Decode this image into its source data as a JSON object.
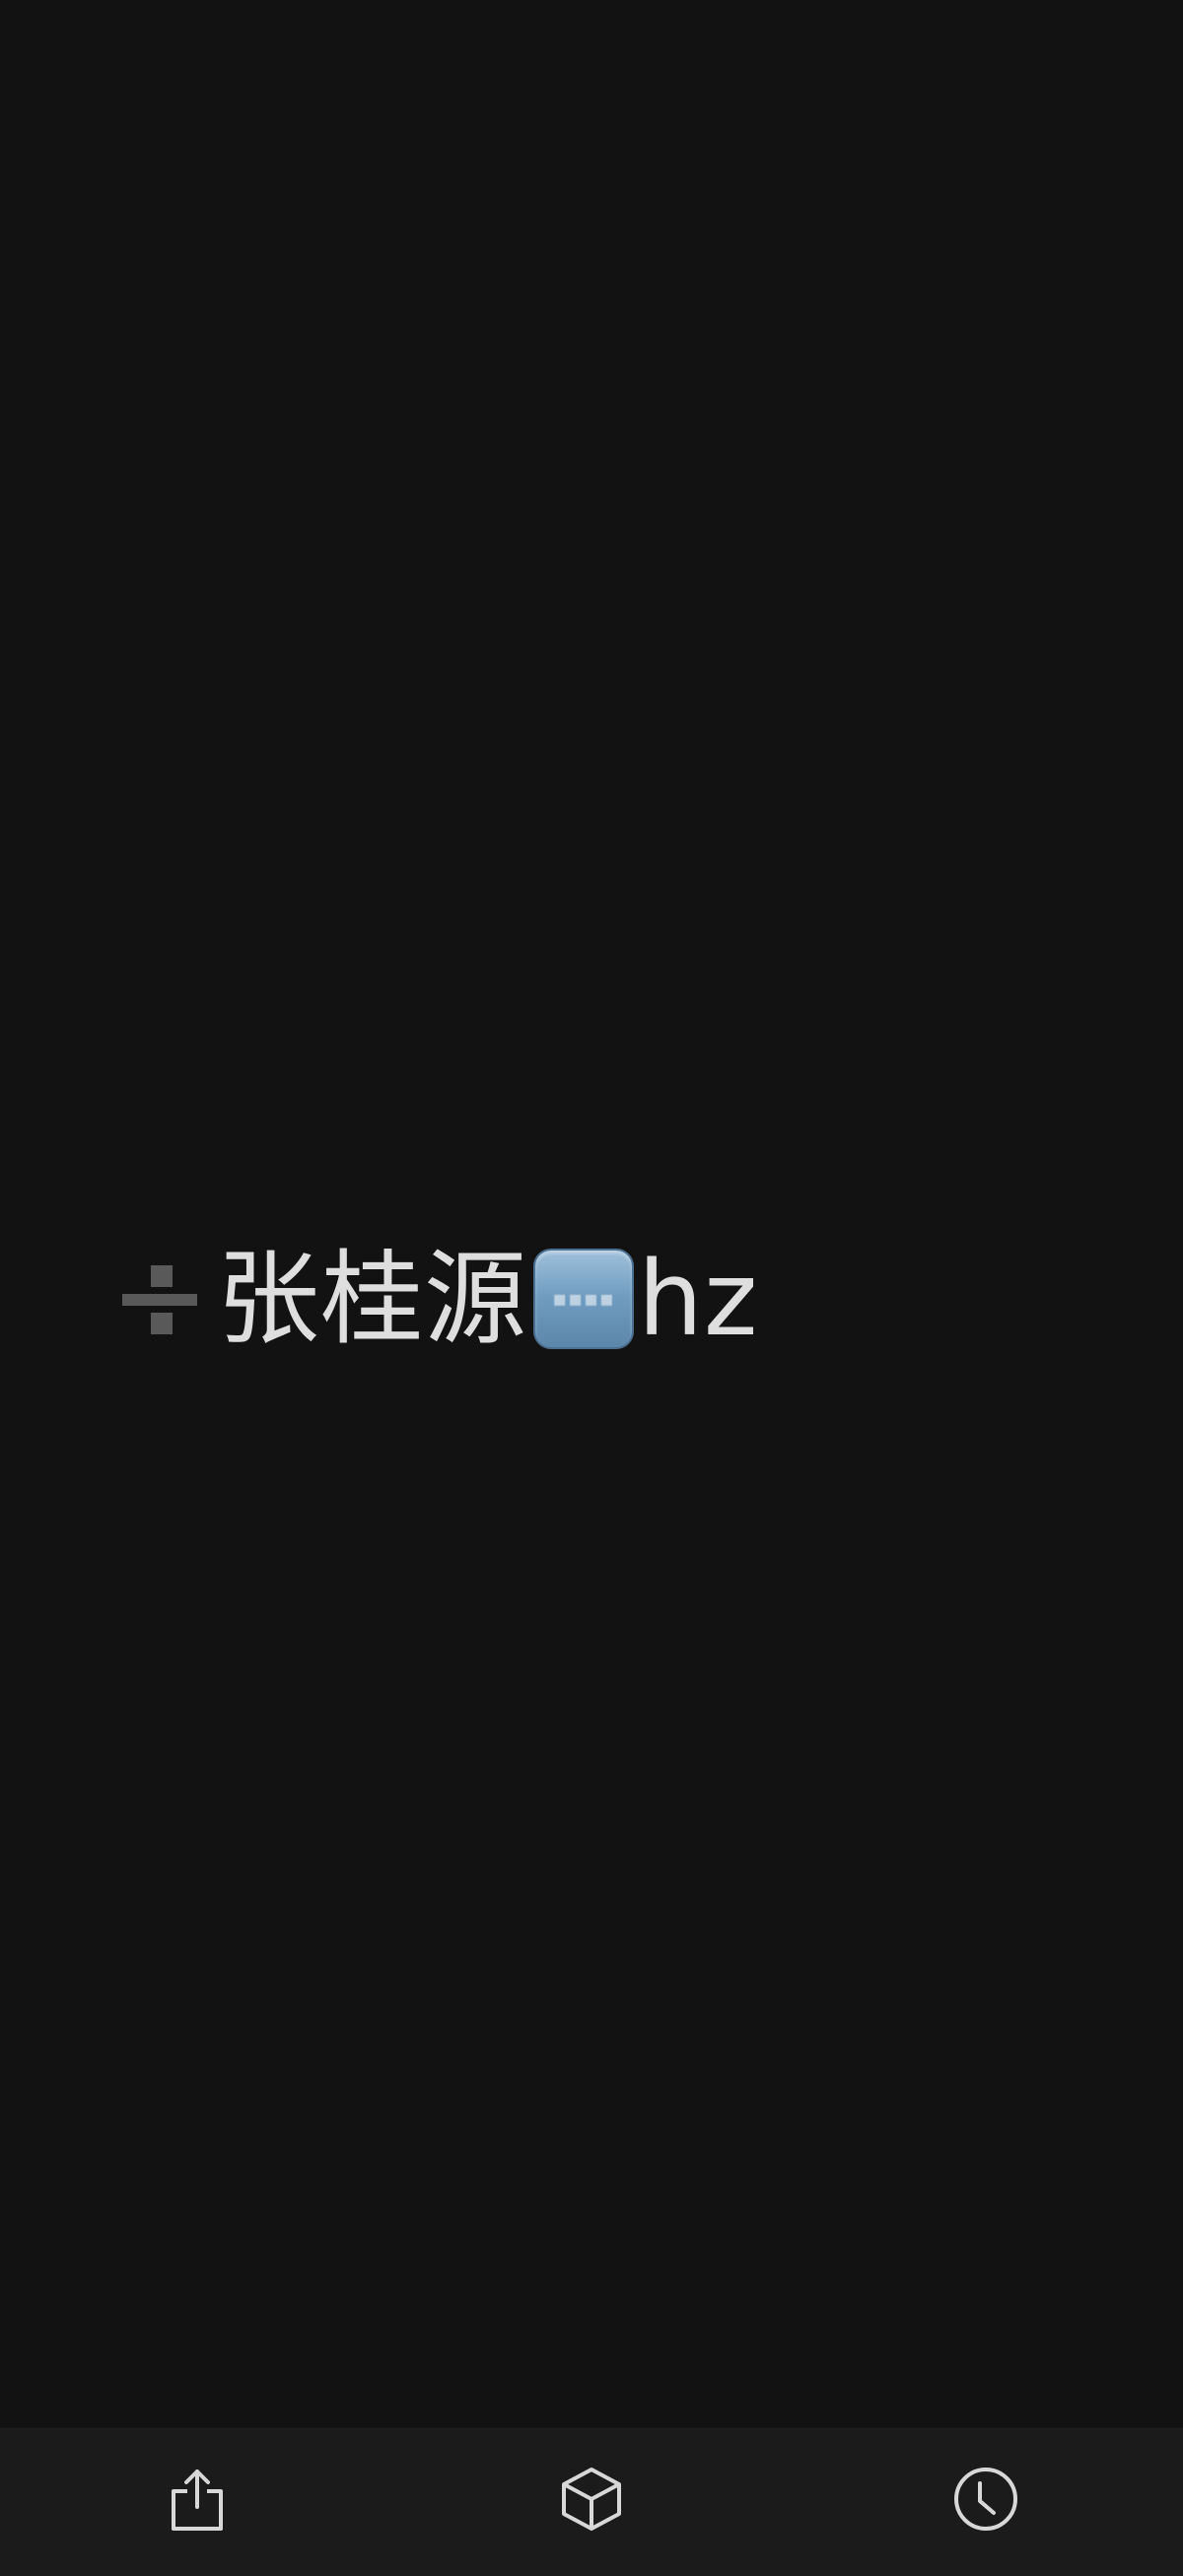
{
  "viewer": {
    "caption": {
      "prefix_icon": "divide-sign-icon",
      "name_text": "张桂源",
      "badge_icon": "blue-key-badge-icon",
      "suffix_text": "hz"
    }
  },
  "toolbar": {
    "buttons": [
      {
        "icon": "share-icon"
      },
      {
        "icon": "cube-3d-icon"
      },
      {
        "icon": "clock-icon"
      }
    ]
  },
  "colors": {
    "background": "#121212",
    "toolbar": "#1b1b1b",
    "text": "#dedede",
    "icon_stroke": "#d8d8d8",
    "badge_blue": "#6f9cc0"
  }
}
